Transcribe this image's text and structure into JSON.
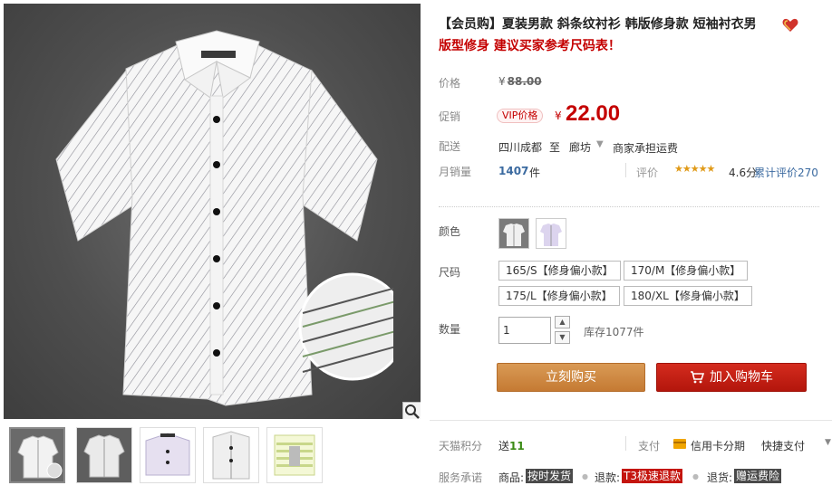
{
  "product": {
    "title": "【会员购】夏装男款 斜条纹衬衫 韩版修身款 短袖衬衣男",
    "subtitle": "版型修身 建议买家参考尺码表！"
  },
  "price": {
    "label": "价格",
    "currency": "¥",
    "original": "88.00"
  },
  "promo": {
    "label": "促销",
    "badge": "VIP价格",
    "currency": "¥",
    "price": "22.00"
  },
  "shipping": {
    "label": "配送",
    "from": "四川成都",
    "to_word": "至",
    "destination": "廊坊",
    "fee_note": "商家承担运费"
  },
  "sales": {
    "label": "月销量",
    "count": "1407",
    "unit": "件",
    "review_label": "评价",
    "stars": "★★★★★",
    "score": "4.6分",
    "review_total": "累计评价270"
  },
  "options": {
    "color_label": "颜色",
    "size_label": "尺码",
    "sizes": [
      "165/S【修身偏小款】",
      "170/M【修身偏小款】",
      "175/L【修身偏小款】",
      "180/XL【修身偏小款】"
    ]
  },
  "quantity": {
    "label": "数量",
    "value": "1",
    "stock": "库存1077件"
  },
  "actions": {
    "buy_now": "立刻购买",
    "add_cart": "加入购物车"
  },
  "points": {
    "label": "天猫积分",
    "prefix": "送",
    "value": "11"
  },
  "payment": {
    "label": "支付",
    "card": "信用卡分期",
    "fast": "快捷支付"
  },
  "service": {
    "label": "服务承诺",
    "goods_prefix": "商品:",
    "goods_tag": "按时发货",
    "return_prefix": "退款:",
    "return_tag": "T3极速退款",
    "refund_prefix": "退货:",
    "refund_tag": "赠运费险"
  },
  "colors": {
    "brand_red": "#c40000",
    "buy_orange": "#c57a33",
    "cart_red": "#b3160c",
    "link_blue": "#3b6aa0",
    "star_gold": "#e09a18"
  },
  "icons": [
    "heart-icon",
    "magnifier-icon",
    "cart-icon",
    "card-icon",
    "chevron-down-icon",
    "arrow-up-icon",
    "arrow-down-icon"
  ]
}
